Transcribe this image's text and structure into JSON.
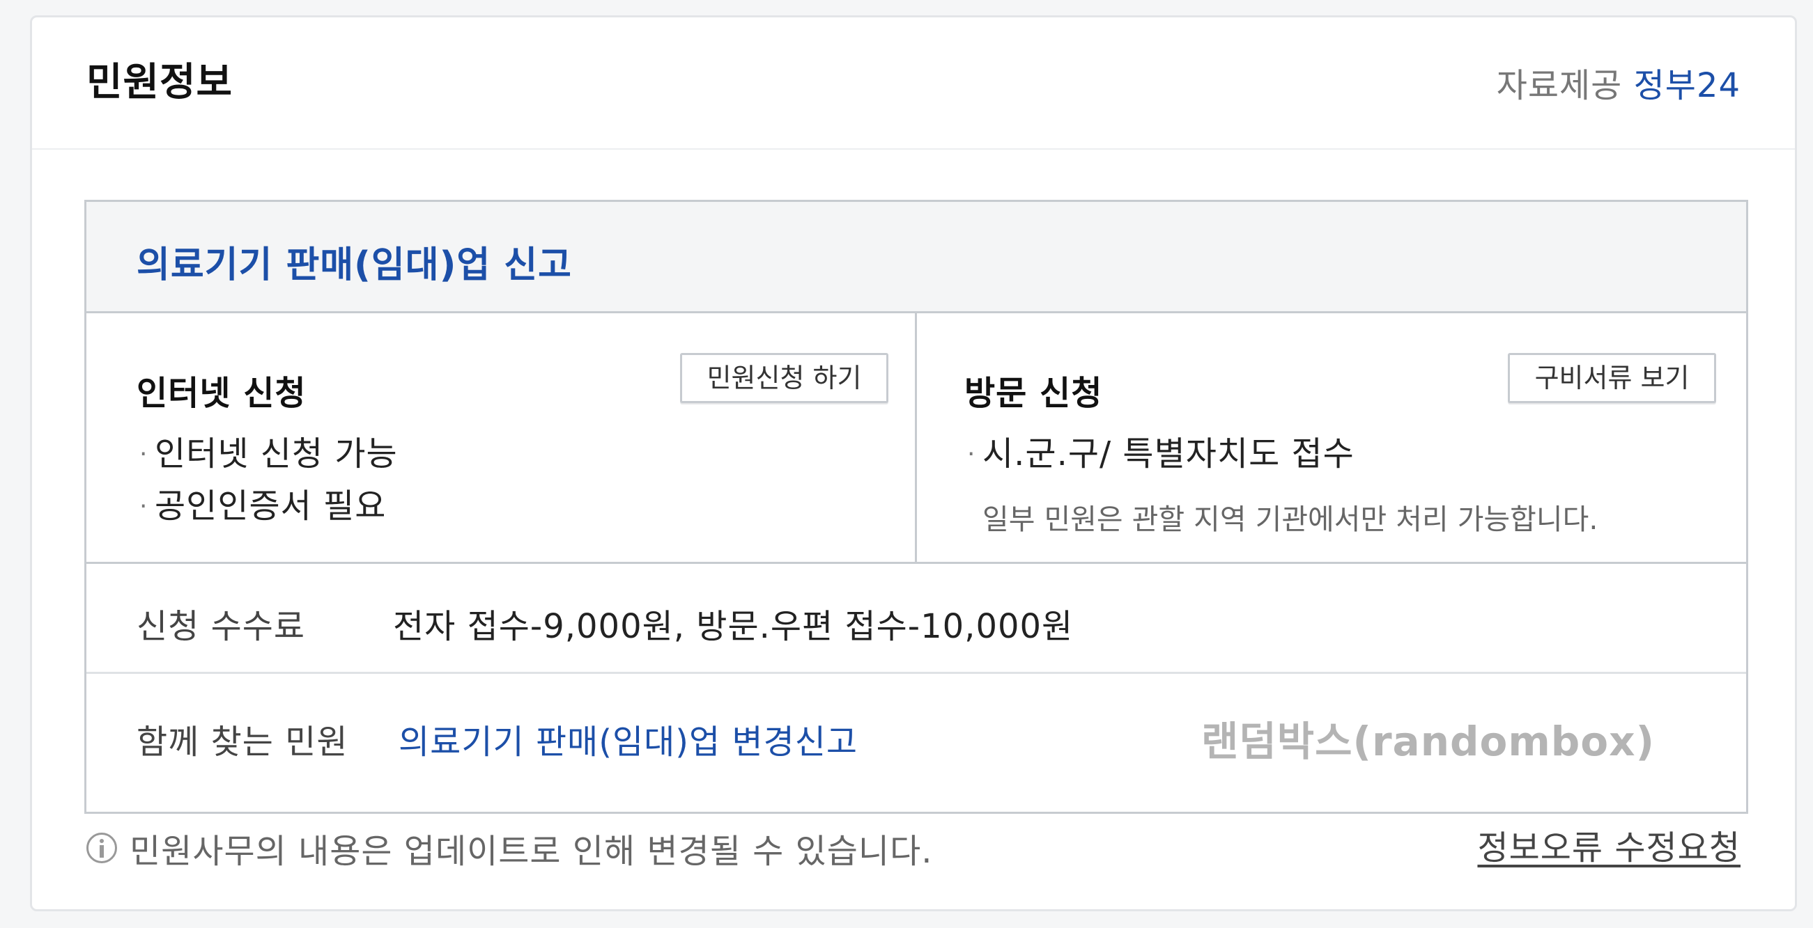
{
  "header": {
    "title": "민원정보",
    "provider_label": "자료제공",
    "provider_name": "정부24"
  },
  "service": {
    "title": "의료기기 판매(임대)업 신고",
    "internet": {
      "heading": "인터넷 신청",
      "button_label": "민원신청 하기",
      "bullets": [
        "인터넷 신청 가능",
        "공인인증서 필요"
      ]
    },
    "visit": {
      "heading": "방문 신청",
      "button_label": "구비서류 보기",
      "bullets": [
        "시.군.구/ 특별자치도 접수"
      ],
      "note": "일부 민원은 관할 지역 기관에서만 처리 가능합니다."
    },
    "fee": {
      "label": "신청 수수료",
      "value": "전자 접수-9,000원, 방문.우편 접수-10,000원"
    },
    "related": {
      "label": "함께 찾는 민원",
      "link": "의료기기 판매(임대)업 변경신고"
    }
  },
  "watermark": "랜덤박스(randombox)",
  "footer": {
    "note": "민원사무의 내용은 업데이트로 인해 변경될 수 있습니다.",
    "error_link": "정보오류 수정요청"
  },
  "icons": {
    "info": "info-icon"
  }
}
